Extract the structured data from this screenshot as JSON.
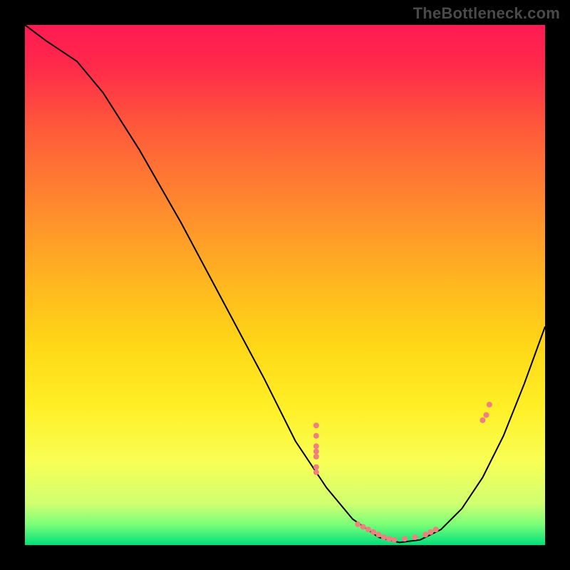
{
  "watermark": "TheBottleneck.com",
  "gradient": {
    "stops": [
      {
        "offset": "0%",
        "color": "#ff1a53"
      },
      {
        "offset": "8%",
        "color": "#ff2a4a"
      },
      {
        "offset": "20%",
        "color": "#ff5a3a"
      },
      {
        "offset": "35%",
        "color": "#ff8a2e"
      },
      {
        "offset": "50%",
        "color": "#ffb81f"
      },
      {
        "offset": "62%",
        "color": "#ffd816"
      },
      {
        "offset": "74%",
        "color": "#fff028"
      },
      {
        "offset": "84%",
        "color": "#f8ff55"
      },
      {
        "offset": "92%",
        "color": "#d0ff70"
      },
      {
        "offset": "96%",
        "color": "#7cff78"
      },
      {
        "offset": "100%",
        "color": "#00e07a"
      }
    ]
  },
  "chart_data": {
    "type": "line",
    "title": "",
    "xlabel": "",
    "ylabel": "",
    "xlim": [
      0,
      100
    ],
    "ylim": [
      0,
      100
    ],
    "curve": [
      {
        "x": 0,
        "y": 100
      },
      {
        "x": 4,
        "y": 97
      },
      {
        "x": 10,
        "y": 93
      },
      {
        "x": 15,
        "y": 87
      },
      {
        "x": 22,
        "y": 76
      },
      {
        "x": 30,
        "y": 62
      },
      {
        "x": 38,
        "y": 47
      },
      {
        "x": 46,
        "y": 32
      },
      {
        "x": 52,
        "y": 20
      },
      {
        "x": 58,
        "y": 11
      },
      {
        "x": 63,
        "y": 5
      },
      {
        "x": 68,
        "y": 1.5
      },
      {
        "x": 72,
        "y": 0.5
      },
      {
        "x": 76,
        "y": 1
      },
      {
        "x": 80,
        "y": 3
      },
      {
        "x": 84,
        "y": 7
      },
      {
        "x": 88,
        "y": 13
      },
      {
        "x": 92,
        "y": 21
      },
      {
        "x": 96,
        "y": 31
      },
      {
        "x": 100,
        "y": 42
      }
    ],
    "marker_clusters": [
      {
        "x_center": 56,
        "y_spread": [
          23,
          21,
          19,
          18,
          17,
          15,
          14
        ],
        "radius": 4
      },
      {
        "x_center": 70,
        "y_spread": [
          4,
          3.5,
          3,
          2.5,
          2,
          1.5,
          1.2,
          1,
          1.2,
          1.5
        ],
        "x_spread": [
          64,
          65,
          66,
          67,
          68,
          69,
          70,
          71,
          73,
          75
        ],
        "radius": 4
      },
      {
        "x_center": 77,
        "y_spread": [
          2,
          2.5,
          3
        ],
        "x_spread": [
          77,
          78,
          79
        ],
        "radius": 4
      },
      {
        "x_center": 88,
        "y_spread": [
          24,
          25,
          27
        ],
        "x_spread": [
          88,
          88.7,
          89.3
        ],
        "radius": 4
      }
    ],
    "marker_color": "#f08080",
    "curve_color": "#000000",
    "curve_width": 2
  }
}
